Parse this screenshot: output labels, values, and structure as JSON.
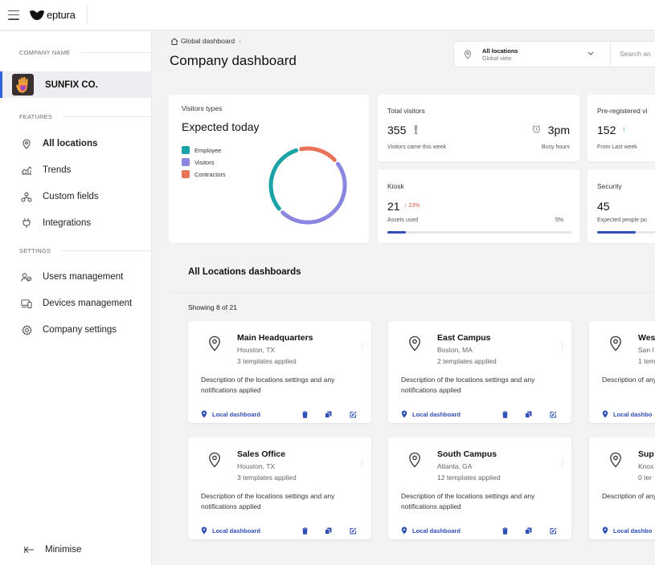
{
  "app": {
    "brand": "eptura"
  },
  "sidebar": {
    "company_section_label": "COMPANY NAME",
    "company_name": "SUNFIX CO.",
    "features_label": "FEATURES",
    "settings_label": "SETTINGS",
    "features": [
      {
        "label": "All locations",
        "icon": "location-pin-icon",
        "active": true
      },
      {
        "label": "Trends",
        "icon": "trends-icon"
      },
      {
        "label": "Custom fields",
        "icon": "custom-fields-icon"
      },
      {
        "label": "Integrations",
        "icon": "plug-icon"
      }
    ],
    "settings": [
      {
        "label": "Users management",
        "icon": "users-icon"
      },
      {
        "label": "Devices management",
        "icon": "devices-icon"
      },
      {
        "label": "Company settings",
        "icon": "gear-icon"
      }
    ],
    "minimise_label": "Minimise"
  },
  "header": {
    "breadcrumb": "Global dashboard",
    "title": "Company dashboard",
    "location_select": {
      "title": "All locations",
      "subtitle": "Global view"
    },
    "search_placeholder": "Search an"
  },
  "visitor_types": {
    "label": "Visitors types",
    "heading": "Expected today",
    "legend": [
      {
        "name": "Employee",
        "color": "#1aa3a6",
        "share": 0.33
      },
      {
        "name": "Visitors",
        "color": "#8b86e0",
        "share": 0.41
      },
      {
        "name": "Contractors",
        "color": "#e8735a",
        "share": 0.18
      }
    ]
  },
  "stats": {
    "total_visitors": {
      "title": "Total visitors",
      "value": "355",
      "sub": "Visitors came this week",
      "busy_value": "3pm",
      "busy_label": "Busy hours"
    },
    "preregistered": {
      "title": "Pre-registered vi",
      "value": "152",
      "sub": "From Last week"
    },
    "kiosk": {
      "title": "Kiosk",
      "value": "21",
      "delta": "23%",
      "sub": "Assets used",
      "pct_label": "5%",
      "progress": 0.1
    },
    "security": {
      "title": "Security",
      "value": "45",
      "sub": "Expected people po",
      "progress": 0.4
    }
  },
  "locations": {
    "section_title": "All Locations dashboards",
    "showing": "Showing 8 of 21",
    "action_label": "Local dashboard",
    "cards": [
      {
        "name": "Main Headquarters",
        "city": "Houston, TX",
        "templates": "3 templates applied",
        "desc": "Description of the locations settings and any notifications applied"
      },
      {
        "name": "East Campus",
        "city": "Boston, MA",
        "templates": "2 templates applied",
        "desc": "Description of the locations settings and any notifications applied"
      },
      {
        "name": "Wes",
        "city": "San I",
        "templates": "1 tem",
        "desc": "Description of any notificatio"
      },
      {
        "name": "Sales Office",
        "city": "Houston, TX",
        "templates": "3 templates applied",
        "desc": "Description of the locations settings and any notifications applied"
      },
      {
        "name": "South Campus",
        "city": "Atlanta, GA",
        "templates": "12 templates applied",
        "desc": "Description of the locations settings and any notifications applied"
      },
      {
        "name": "Sup",
        "city": "Knox",
        "templates": "0 ter",
        "desc": "Description of any notificatio"
      }
    ],
    "partial_action_label": "Local dashbo"
  },
  "colors": {
    "accent": "#2f62d7",
    "link": "#2f4fb5",
    "up": "#e44d4d",
    "up_green": "#2aa876"
  }
}
